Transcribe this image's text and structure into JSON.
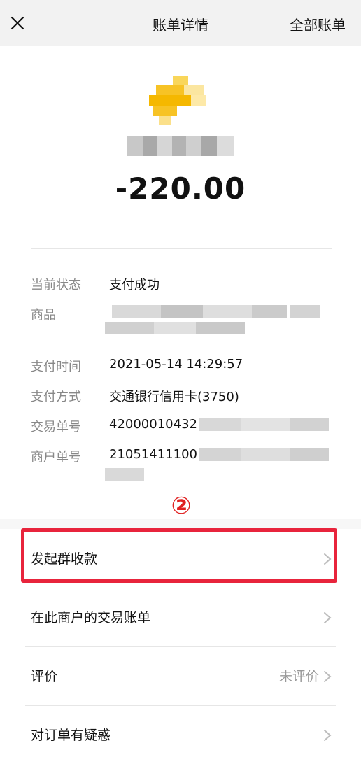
{
  "topbar": {
    "title": "账单详情",
    "all_bills_label": "全部账单",
    "close_icon": "close-icon"
  },
  "amount": "-220.00",
  "details": [
    {
      "label": "当前状态",
      "value": "支付成功"
    },
    {
      "label": "商品",
      "value": ""
    },
    {
      "label": "支付时间",
      "value": "2021-05-14 14:29:57"
    },
    {
      "label": "支付方式",
      "value": "交通银行信用卡(3750)"
    },
    {
      "label": "交易单号",
      "value": "42000010432"
    },
    {
      "label": "商户单号",
      "value": "21051411100"
    }
  ],
  "annotation": {
    "step_marker": "②",
    "highlight_color": "#e8243c"
  },
  "actions": [
    {
      "label": "发起群收款",
      "value": ""
    },
    {
      "label": "在此商户的交易账单",
      "value": ""
    },
    {
      "label": "评价",
      "value": "未评价"
    },
    {
      "label": "对订单有疑惑",
      "value": ""
    }
  ],
  "colors": {
    "accent_red": "#e8243c",
    "label_gray": "#888888",
    "logo_yellow": "#f7c325"
  }
}
